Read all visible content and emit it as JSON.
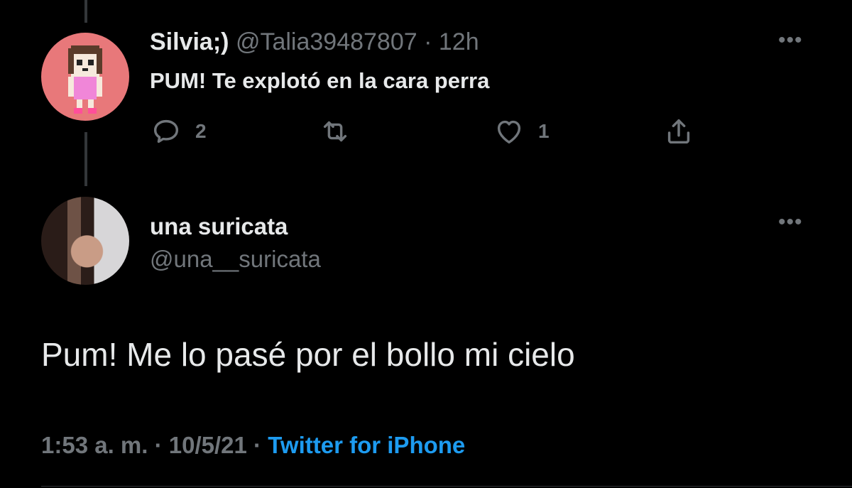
{
  "reply_to_tweet": {
    "author_name": "Silvia;)",
    "author_handle": "@Talia39487807",
    "separator": "·",
    "time": "12h",
    "text": "PUM! Te explotó en la cara perra",
    "more_icon": "more-icon",
    "actions": {
      "reply_count": "2",
      "like_count": "1"
    },
    "avatar_color": "#e8787a"
  },
  "main_tweet": {
    "author_name": "una suricata",
    "author_handle": "@una__suricata",
    "text": "Pum! Me lo pasé por el bollo mi cielo",
    "timestamp": "1:53 a. m.",
    "date": "10/5/21",
    "source": "Twitter for iPhone",
    "separator": "·"
  },
  "colors": {
    "background": "#000000",
    "primary_text": "#e7e9ea",
    "secondary_text": "#71767b",
    "link": "#1d9bf0"
  }
}
